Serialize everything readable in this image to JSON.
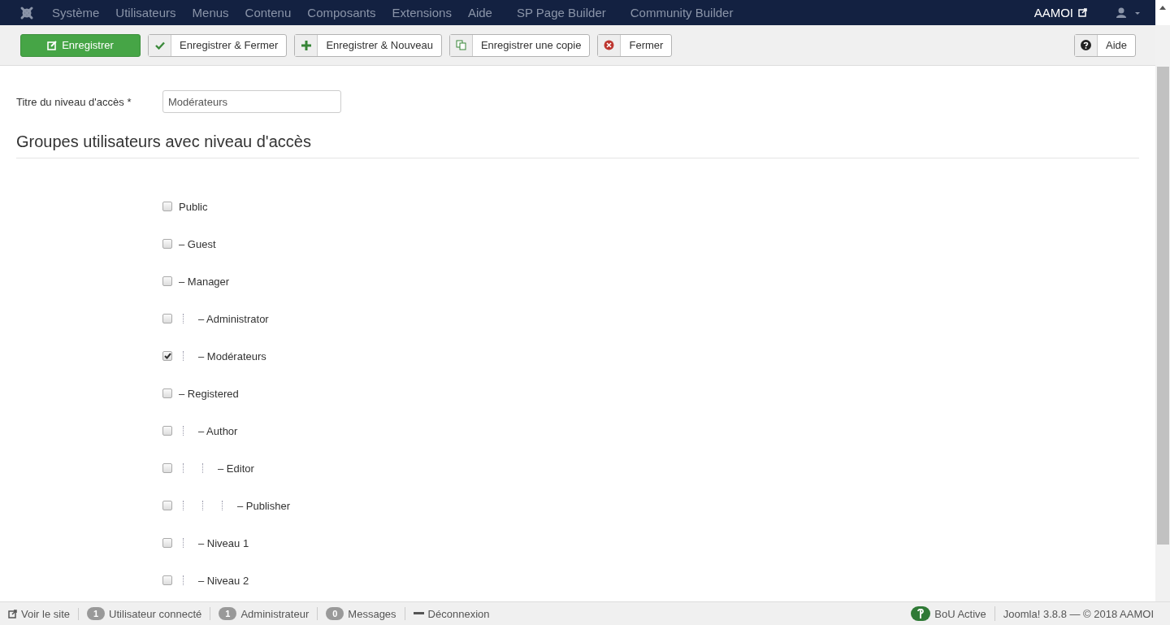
{
  "menu": {
    "items": [
      "Système",
      "Utilisateurs",
      "Menus",
      "Contenu",
      "Composants",
      "Extensions",
      "Aide",
      "SP Page Builder",
      "Community Builder"
    ],
    "site_name": "AAMOI"
  },
  "toolbar": {
    "buttons": [
      {
        "label": "Enregistrer",
        "kind": "primary"
      },
      {
        "label": "Enregistrer & Fermer",
        "kind": "check"
      },
      {
        "label": "Enregistrer & Nouveau",
        "kind": "plus"
      },
      {
        "label": "Enregistrer une copie",
        "kind": "copy"
      },
      {
        "label": "Fermer",
        "kind": "close"
      }
    ],
    "help": {
      "label": "Aide"
    }
  },
  "title_field": {
    "label": "Titre du niveau d'accès *",
    "value": "Modérateurs"
  },
  "section_title": "Groupes utilisateurs avec niveau d'accès",
  "groups": [
    {
      "label": "Public",
      "checked": false,
      "children": [
        {
          "label": "– Guest",
          "checked": false
        },
        {
          "label": "– Manager",
          "checked": false,
          "children": [
            {
              "label": "– Administrator",
              "checked": false
            },
            {
              "label": "– Modérateurs",
              "checked": true
            }
          ]
        },
        {
          "label": "– Registered",
          "checked": false,
          "children": [
            {
              "label": "– Author",
              "checked": false,
              "children": [
                {
                  "label": "– Editor",
                  "checked": false,
                  "children": [
                    {
                      "label": "– Publisher",
                      "checked": false
                    }
                  ]
                }
              ]
            },
            {
              "label": "– Niveau 1",
              "checked": false
            },
            {
              "label": "– Niveau 2",
              "checked": false
            }
          ]
        }
      ]
    }
  ],
  "status_bar": {
    "left": [
      {
        "kind": "link",
        "label": "Voir le site"
      },
      {
        "kind": "count",
        "count": "1",
        "label": "Utilisateur connecté"
      },
      {
        "kind": "count",
        "count": "1",
        "label": "Administrateur"
      },
      {
        "kind": "count",
        "count": "0",
        "label": "Messages"
      },
      {
        "kind": "logout",
        "label": "Déconnexion"
      }
    ],
    "right": [
      {
        "kind": "badge",
        "label": "BoU Active"
      },
      {
        "kind": "text",
        "label": "Joomla! 3.8.8 — © 2018 AAMOI"
      }
    ]
  }
}
